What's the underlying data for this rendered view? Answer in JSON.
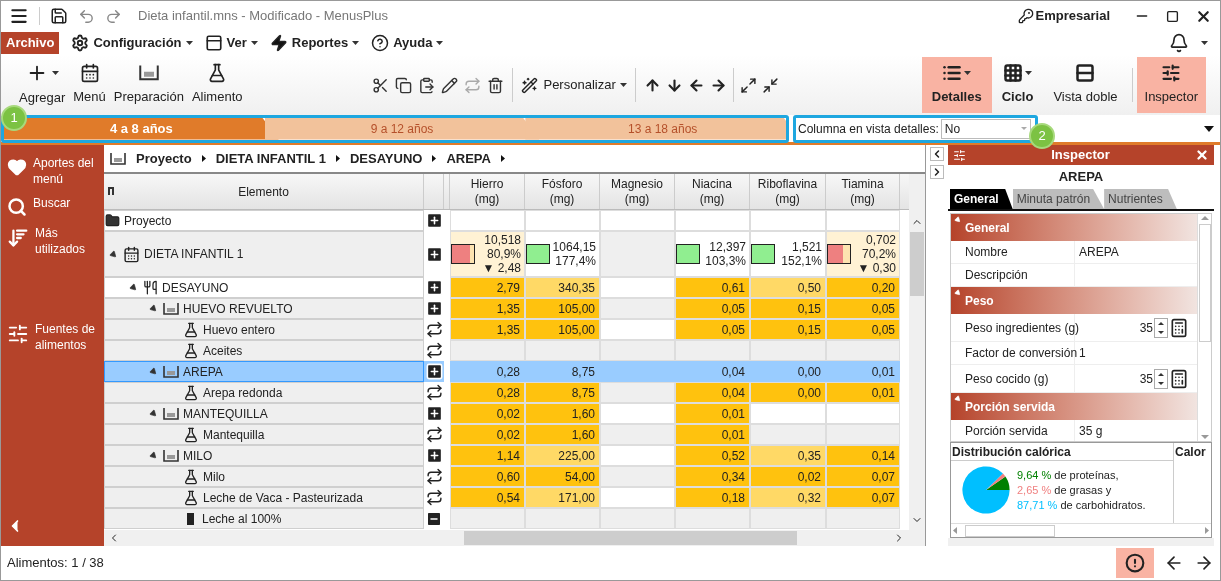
{
  "window": {
    "title": "Dieta infantil.mns - Modificado - MenusPlus",
    "license": "Empresarial"
  },
  "menu": [
    {
      "label": "Archivo",
      "kind": "file"
    },
    {
      "label": "Configuración",
      "kind": "menu"
    },
    {
      "label": "Ver",
      "kind": "menu"
    },
    {
      "label": "Reportes",
      "kind": "menu"
    },
    {
      "label": "Ayuda",
      "kind": "menu"
    }
  ],
  "toolbar": {
    "add_tools": [
      {
        "label": "Agregar",
        "dropdown": true
      },
      {
        "label": "Menú",
        "dropdown": false
      },
      {
        "label": "Preparación",
        "dropdown": false
      },
      {
        "label": "Alimento",
        "dropdown": false
      }
    ],
    "edit_tools": [
      {
        "disabled": false
      },
      {
        "disabled": false
      },
      {
        "disabled": false
      },
      {
        "disabled": false
      },
      {
        "disabled": true
      },
      {
        "disabled": false
      }
    ],
    "customize": {
      "label": "Personalizar"
    },
    "view_tools": [
      {
        "label": "Detalles",
        "selected": true,
        "dropdown": true
      },
      {
        "label": "Ciclo",
        "selected": false,
        "dropdown": true
      },
      {
        "label": "Vista doble",
        "selected": false,
        "dropdown": false
      }
    ],
    "inspector_toggle": {
      "label": "Inspector",
      "selected": true
    }
  },
  "age_tabs": [
    {
      "label": "4 a 8 años",
      "selected": true
    },
    {
      "label": "9 a 12 años",
      "selected": false
    },
    {
      "label": "13 a 18 años",
      "selected": false
    }
  ],
  "detail_column": {
    "label": "Columna en vista detalles:",
    "value": "No"
  },
  "callouts": [
    {
      "label": "1"
    },
    {
      "label": "2"
    }
  ],
  "sidebar": [
    {
      "label": "Aportes del menú"
    },
    {
      "label": "Buscar"
    },
    {
      "label": "Más utilizados"
    },
    {
      "label": "Fuentes de alimentos"
    }
  ],
  "breadcrumb": [
    "Proyecto",
    "DIETA INFANTIL 1",
    "DESAYUNO",
    "AREPA"
  ],
  "table": {
    "first_column": "Elemento",
    "columns": [
      {
        "name": "Hierro",
        "unit": "(mg)"
      },
      {
        "name": "Fósforo",
        "unit": "(mg)"
      },
      {
        "name": "Magnesio",
        "unit": "(mg)"
      },
      {
        "name": "Niacina",
        "unit": "(mg)"
      },
      {
        "name": "Riboflavina",
        "unit": "(mg)"
      },
      {
        "name": "Tiamina",
        "unit": "(mg)"
      }
    ],
    "rows": [
      {
        "label": "Proyecto",
        "kind": "project",
        "selected": false
      },
      {
        "label": "DIETA INFANTIL 1",
        "kind": "diet",
        "selected": false,
        "expanded": true,
        "summary": [
          {
            "kind": "gauge",
            "lines": [
              "10,518",
              "80,9%",
              "▼ 2,48"
            ],
            "level": 0.81,
            "low": true
          },
          {
            "kind": "gauge",
            "lines": [
              "1064,15",
              "177,4%"
            ],
            "level": 1,
            "low": false
          },
          {
            "kind": "empty"
          },
          {
            "kind": "gauge",
            "lines": [
              "12,397",
              "103,3%"
            ],
            "level": 1,
            "low": false
          },
          {
            "kind": "gauge",
            "lines": [
              "1,521",
              "152,1%"
            ],
            "level": 1,
            "low": false
          },
          {
            "kind": "gauge",
            "lines": [
              "0,702",
              "70,2%",
              "▼ 0,30"
            ],
            "level": 0.7,
            "low": true
          }
        ],
        "children": [
          {
            "label": "DESAYUNO",
            "kind": "meal",
            "selected": false,
            "expanded": true,
            "cells": [
              {
                "kind": "value",
                "value": "2,79",
                "color": "#ffc20e"
              },
              {
                "kind": "value",
                "value": "340,35",
                "color": "#ffd966"
              },
              {
                "kind": "empty"
              },
              {
                "kind": "value",
                "value": "0,61",
                "color": "#ffc20e"
              },
              {
                "kind": "value",
                "value": "0,50",
                "color": "#ffd966"
              },
              {
                "kind": "value",
                "value": "0,20",
                "color": "#ffc20e"
              }
            ],
            "children": [
              {
                "label": "HUEVO REVUELTO",
                "kind": "recipe",
                "selected": false,
                "expanded": true,
                "cells": [
                  {
                    "kind": "value",
                    "value": "1,35",
                    "color": "#ffc20e"
                  },
                  {
                    "kind": "value",
                    "value": "105,00",
                    "color": "#ffc20e"
                  },
                  {
                    "kind": "empty"
                  },
                  {
                    "kind": "value",
                    "value": "0,05",
                    "color": "#ffc20e"
                  },
                  {
                    "kind": "value",
                    "value": "0,15",
                    "color": "#ffc20e"
                  },
                  {
                    "kind": "value",
                    "value": "0,05",
                    "color": "#ffc20e"
                  }
                ],
                "children": [
                  {
                    "label": "Huevo entero",
                    "kind": "food",
                    "selected": false,
                    "cells": [
                      {
                        "kind": "value",
                        "value": "1,35",
                        "color": "#ffc20e"
                      },
                      {
                        "kind": "value",
                        "value": "105,00",
                        "color": "#ffc20e"
                      },
                      {
                        "kind": "empty"
                      },
                      {
                        "kind": "value",
                        "value": "0,05",
                        "color": "#ffc20e"
                      },
                      {
                        "kind": "value",
                        "value": "0,15",
                        "color": "#ffc20e"
                      },
                      {
                        "kind": "value",
                        "value": "0,05",
                        "color": "#ffc20e"
                      }
                    ]
                  },
                  {
                    "label": "Aceites",
                    "kind": "food",
                    "selected": false,
                    "cells": [
                      {
                        "kind": "empty"
                      },
                      {
                        "kind": "empty"
                      },
                      {
                        "kind": "empty"
                      },
                      {
                        "kind": "empty"
                      },
                      {
                        "kind": "empty"
                      },
                      {
                        "kind": "empty"
                      }
                    ]
                  }
                ]
              },
              {
                "label": "AREPA",
                "kind": "recipe",
                "selected": true,
                "expanded": true,
                "cells": [
                  {
                    "kind": "value",
                    "value": "0,28"
                  },
                  {
                    "kind": "value",
                    "value": "8,75"
                  },
                  {
                    "kind": "empty"
                  },
                  {
                    "kind": "value",
                    "value": "0,04"
                  },
                  {
                    "kind": "value",
                    "value": "0,00"
                  },
                  {
                    "kind": "value",
                    "value": "0,01"
                  }
                ],
                "children": [
                  {
                    "label": "Arepa redonda",
                    "kind": "food",
                    "selected": false,
                    "cells": [
                      {
                        "kind": "value",
                        "value": "0,28",
                        "color": "#ffc20e"
                      },
                      {
                        "kind": "value",
                        "value": "8,75",
                        "color": "#ffc20e"
                      },
                      {
                        "kind": "empty"
                      },
                      {
                        "kind": "value",
                        "value": "0,04",
                        "color": "#ffc20e"
                      },
                      {
                        "kind": "value",
                        "value": "0,00",
                        "color": "#ffc20e"
                      },
                      {
                        "kind": "value",
                        "value": "0,01",
                        "color": "#ffc20e"
                      }
                    ]
                  }
                ]
              },
              {
                "label": "MANTEQUILLA",
                "kind": "recipe",
                "selected": false,
                "expanded": true,
                "cells": [
                  {
                    "kind": "value",
                    "value": "0,02",
                    "color": "#ffc20e"
                  },
                  {
                    "kind": "value",
                    "value": "1,60",
                    "color": "#ffc20e"
                  },
                  {
                    "kind": "empty"
                  },
                  {
                    "kind": "value",
                    "value": "0,01",
                    "color": "#ffc20e"
                  },
                  {
                    "kind": "empty"
                  },
                  {
                    "kind": "empty"
                  }
                ],
                "children": [
                  {
                    "label": "Mantequilla",
                    "kind": "food",
                    "selected": false,
                    "cells": [
                      {
                        "kind": "value",
                        "value": "0,02",
                        "color": "#ffc20e"
                      },
                      {
                        "kind": "value",
                        "value": "1,60",
                        "color": "#ffc20e"
                      },
                      {
                        "kind": "empty"
                      },
                      {
                        "kind": "value",
                        "value": "0,01",
                        "color": "#ffc20e"
                      },
                      {
                        "kind": "empty"
                      },
                      {
                        "kind": "empty"
                      }
                    ]
                  }
                ]
              },
              {
                "label": "MILO",
                "kind": "recipe",
                "selected": false,
                "expanded": true,
                "cells": [
                  {
                    "kind": "value",
                    "value": "1,14",
                    "color": "#ffc20e"
                  },
                  {
                    "kind": "value",
                    "value": "225,00",
                    "color": "#ffd966"
                  },
                  {
                    "kind": "empty"
                  },
                  {
                    "kind": "value",
                    "value": "0,52",
                    "color": "#ffc20e"
                  },
                  {
                    "kind": "value",
                    "value": "0,35",
                    "color": "#ffd966"
                  },
                  {
                    "kind": "value",
                    "value": "0,14",
                    "color": "#ffc20e"
                  }
                ],
                "children": [
                  {
                    "label": "Milo",
                    "kind": "food",
                    "selected": false,
                    "cells": [
                      {
                        "kind": "value",
                        "value": "0,60",
                        "color": "#ffc20e"
                      },
                      {
                        "kind": "value",
                        "value": "54,00",
                        "color": "#ffc20e"
                      },
                      {
                        "kind": "empty"
                      },
                      {
                        "kind": "value",
                        "value": "0,34",
                        "color": "#ffc20e"
                      },
                      {
                        "kind": "value",
                        "value": "0,02",
                        "color": "#ffc20e"
                      },
                      {
                        "kind": "value",
                        "value": "0,07",
                        "color": "#ffc20e"
                      }
                    ]
                  },
                  {
                    "label": "Leche de Vaca - Pasteurizada",
                    "kind": "food",
                    "selected": false,
                    "cells": [
                      {
                        "kind": "value",
                        "value": "0,54",
                        "color": "#ffc20e"
                      },
                      {
                        "kind": "value",
                        "value": "171,00",
                        "color": "#ffd966"
                      },
                      {
                        "kind": "empty"
                      },
                      {
                        "kind": "value",
                        "value": "0,18",
                        "color": "#ffc20e"
                      },
                      {
                        "kind": "value",
                        "value": "0,32",
                        "color": "#ffd966"
                      },
                      {
                        "kind": "value",
                        "value": "0,07",
                        "color": "#ffc20e"
                      }
                    ]
                  },
                  {
                    "label": "Leche al 100%",
                    "kind": "food_alt",
                    "selected": false,
                    "cells": [
                      {
                        "kind": "empty"
                      },
                      {
                        "kind": "empty"
                      },
                      {
                        "kind": "empty"
                      },
                      {
                        "kind": "empty"
                      },
                      {
                        "kind": "empty"
                      },
                      {
                        "kind": "empty"
                      }
                    ]
                  }
                ]
              }
            ]
          }
        ]
      }
    ]
  },
  "inspector": {
    "title": "Inspector",
    "subject": "AREPA",
    "tabs": [
      {
        "label": "General",
        "selected": true
      },
      {
        "label": "Minuta patrón",
        "selected": false
      },
      {
        "label": "Nutrientes",
        "selected": false
      }
    ],
    "sections": [
      {
        "title": "General",
        "expanded": true,
        "props": [
          {
            "name": "Nombre",
            "value": "AREPA",
            "kind": "text"
          },
          {
            "name": "Descripción",
            "kind": "text"
          }
        ]
      },
      {
        "title": "Peso",
        "expanded": true,
        "props": [
          {
            "name": "Peso ingredientes (g)",
            "value": "35",
            "kind": "spin"
          },
          {
            "name": "Factor de conversión",
            "value": "1",
            "kind": "text"
          },
          {
            "name": "Peso cocido (g)",
            "value": "35",
            "kind": "spin"
          }
        ]
      },
      {
        "title": "Porción servida",
        "expanded": true,
        "props": [
          {
            "name": "Porción servida",
            "value": "35 g",
            "kind": "text"
          }
        ]
      }
    ],
    "distribution": {
      "title": "Distribución calórica",
      "column_2": "Calor",
      "items": [
        {
          "value": "9,64",
          "unit": "%",
          "text": "de proteínas,",
          "color": "#008000"
        },
        {
          "value": "2,65",
          "unit": "%",
          "text": "de grasas y",
          "color": "#f08080"
        },
        {
          "value": "87,71",
          "unit": "%",
          "text": "de carbohidratos.",
          "color": "#00bfff"
        }
      ],
      "chart_data": {
        "type": "pie",
        "series": [
          {
            "values": [
              9.64,
              2.65,
              87.71
            ]
          }
        ]
      }
    }
  },
  "status_bar": {
    "text": "Alimentos: 1 / 38",
    "alert_selected": true
  }
}
